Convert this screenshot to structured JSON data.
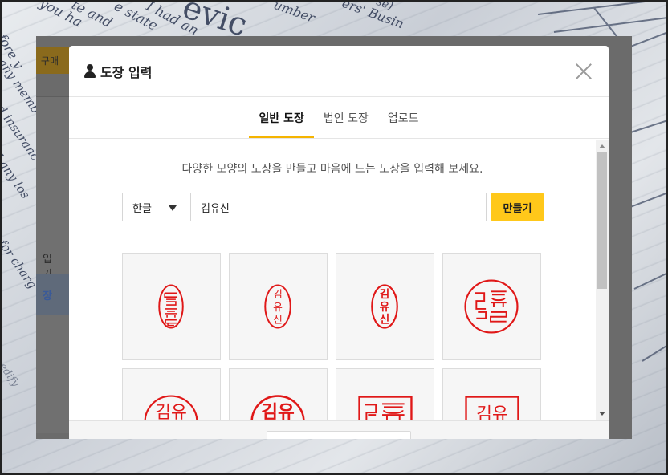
{
  "background": {
    "words": [
      "you ha",
      "te and",
      "e state",
      "I had an",
      "evic",
      "umber",
      "ers' Busin",
      "se)",
      "before y",
      "r any memb",
      "ed insuranc",
      "d any los",
      "s for charg",
      "edify"
    ]
  },
  "underlying_page": {
    "buy_button": "구매",
    "sidebar_items": [
      "입기",
      "장"
    ]
  },
  "modal": {
    "title": "도장 입력",
    "close_icon": "close-icon",
    "tabs": [
      {
        "label": "일반 도장",
        "active": true
      },
      {
        "label": "법인 도장",
        "active": false
      },
      {
        "label": "업로드",
        "active": false
      }
    ],
    "description": "다양한 모양의 도장을 만들고 마음에 드는 도장을 입력해 보세요.",
    "language_select": {
      "value": "한글"
    },
    "name_input": {
      "value": "김유신"
    },
    "make_button": "만들기",
    "stamps": [
      {
        "style": "oval-seal-script",
        "text": "김유신"
      },
      {
        "style": "oval-vertical",
        "text": "김유신"
      },
      {
        "style": "oval-vertical-bold",
        "text": "김유신"
      },
      {
        "style": "round-seal-script",
        "text": "김유신"
      },
      {
        "style": "round-gothic",
        "text": "김유"
      },
      {
        "style": "round-gothic-bold",
        "text": "김유"
      },
      {
        "style": "square-seal-script",
        "text": "김유"
      },
      {
        "style": "square-gothic",
        "text": "김유"
      }
    ],
    "accent_color": "#ffc81a",
    "stamp_color": "#e01818"
  }
}
